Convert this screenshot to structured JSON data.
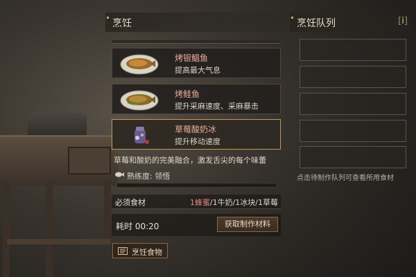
{
  "cooking": {
    "title": "烹饪",
    "recipes": [
      {
        "name": "烤银鲳鱼",
        "effect": "提高最大气息",
        "icon": "grilled-fish-icon"
      },
      {
        "name": "烤鲑鱼",
        "effect": "提升采麻速度、采麻暴击",
        "icon": "grilled-salmon-icon"
      },
      {
        "name": "草莓酸奶冰",
        "effect": "提升移动速度",
        "icon": "strawberry-yogurt-ice-icon"
      }
    ],
    "selected_index": 2,
    "description": "草莓和酸奶的完美融合，激发舌尖的每个味蕾",
    "proficiency": {
      "label": "熟练度: 领悟",
      "progress": 0.0
    },
    "ingredients": {
      "label": "必须食材",
      "required": "1蜂蜜",
      "rest": "/1牛奶/1冰块/1草莓"
    },
    "time": {
      "label": "耗时 00:20"
    },
    "get_materials_button": "获取制作材料",
    "cook_food_button": "烹饪食物"
  },
  "queue": {
    "title": "烹饪队列",
    "info_button": "i",
    "slots": 5,
    "hint": "点击待制作队列可查看所用食材"
  },
  "colors": {
    "accent_gold": "#c49a5e",
    "recipe_name": "#e6a99a",
    "required_ingredient": "#e08a7e"
  }
}
